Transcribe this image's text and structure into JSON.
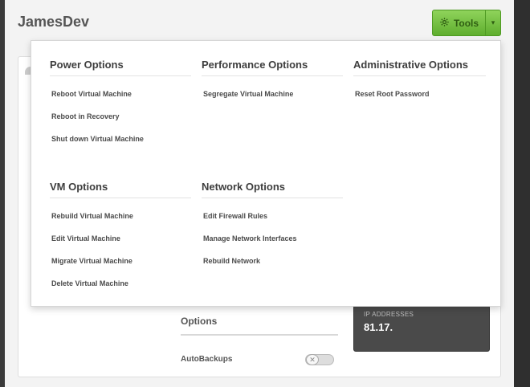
{
  "app": {
    "title": "JamesDev"
  },
  "tools": {
    "label": "Tools",
    "icon": "gear-icon",
    "caret": "▾"
  },
  "menu": {
    "power": {
      "heading": "Power Options",
      "items": [
        "Reboot Virtual Machine",
        "Reboot in Recovery",
        "Shut down Virtual Machine"
      ]
    },
    "performance": {
      "heading": "Performance Options",
      "items": [
        "Segregate Virtual Machine"
      ]
    },
    "administrative": {
      "heading": "Administrative Options",
      "items": [
        "Reset Root Password"
      ]
    },
    "vm": {
      "heading": "VM Options",
      "items": [
        "Rebuild Virtual Machine",
        "Edit Virtual Machine",
        "Migrate Virtual Machine",
        "Delete Virtual Machine"
      ]
    },
    "network": {
      "heading": "Network Options",
      "items": [
        "Edit Firewall Rules",
        "Manage Network Interfaces",
        "Rebuild Network"
      ]
    }
  },
  "ip": {
    "label": "IP ADDRESSES",
    "value": "81.17."
  },
  "options": {
    "heading": "Options",
    "autobackups_label": "AutoBackups",
    "autobackups_on": false
  },
  "colors": {
    "accent": "#5fae2e",
    "panel_dark": "#4a4a4a"
  }
}
